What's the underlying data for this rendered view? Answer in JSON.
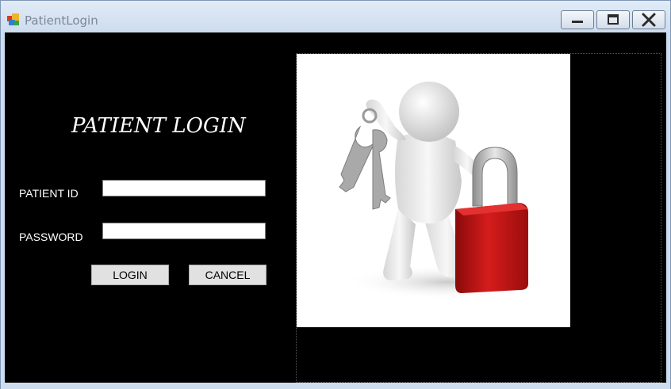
{
  "window": {
    "title": "PatientLogin",
    "icons": {
      "app": "app-icon",
      "minimize": "minimize-icon",
      "maximize": "maximize-icon",
      "close": "close-icon"
    }
  },
  "form": {
    "heading": "PATIENT LOGIN",
    "patient_id_label": "PATIENT ID",
    "patient_id_value": "",
    "password_label": "PASSWORD",
    "password_value": "",
    "login_label": "LOGIN",
    "cancel_label": "CANCEL"
  },
  "illustration": {
    "icon": "person-with-keys-and-padlock-icon"
  },
  "colors": {
    "client_bg": "#000000",
    "padlock_red": "#c41414",
    "titlebar": "#dbe6f4"
  }
}
